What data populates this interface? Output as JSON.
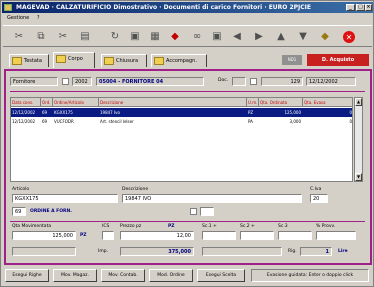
{
  "window": {
    "title": "MAGEVAD · CALZATURIFICIO Dimostrativo · Documenti di carico Fornitori · EURO 2PJCIE"
  },
  "menu": {
    "items": [
      "Gestione",
      "?"
    ]
  },
  "tabs": [
    {
      "label": "Testata"
    },
    {
      "label": "Corpo"
    },
    {
      "label": "Chiusura"
    },
    {
      "label": "Accompagn."
    }
  ],
  "header_badges": {
    "magazzino": "ND1",
    "document_type": "D. Acquisto"
  },
  "document": {
    "tipo": "Fornitore",
    "anno": "2002",
    "fornitore": "05004 - FORNITORE 04",
    "doc_label": "Doc.",
    "doc_type": "",
    "doc_number": "129",
    "doc_date": "12/12/2002"
  },
  "grid": {
    "columns": [
      "Data cons.",
      "Ord.",
      "Ordine/Articolo",
      "Descrizione",
      "U.m.",
      "Qta. Ordinata",
      "Qta. Evasa"
    ],
    "rows": [
      {
        "data": "12/12/2002",
        "ord": "69",
        "articolo": "KGXX175",
        "descrizione": "19847 Ivo",
        "um": "PZ",
        "qta_ord": "125,000",
        "qta_evasa": "0",
        "selected": true
      },
      {
        "data": "12/12/2002",
        "ord": "69",
        "articolo": "VUCFODR",
        "descrizione": "Art. stencil lelser",
        "um": "PA",
        "qta_ord": "3,000",
        "qta_evasa": "0",
        "selected": false
      }
    ]
  },
  "detail": {
    "articolo_label": "Articolo",
    "articolo": "KGXX175",
    "descrizione_label": "Descrizione",
    "descrizione": "19847 IVO",
    "iva_label": "C.Iva",
    "iva": "20",
    "ordine_num": "69",
    "ordine_text": "ORDINE A FORN.",
    "qta_label": "Qta Movimentata",
    "qta": "125,000",
    "um": "PZ",
    "ics_label": "ICS",
    "prezzo_label": "Prezzo pz",
    "prezzo_um": "PZ",
    "prezzo": "12,00",
    "sc1_label": "Sc.1 +",
    "sc2_label": "Sc.2 +",
    "sc3_label": "Sc.3",
    "provv_label": "% Provv.",
    "importo_label": "Imp.",
    "importo": "375,000",
    "righe_label": "Rig.",
    "righe": "1",
    "stato": "Lire"
  },
  "statusbar": {
    "buttons": [
      "Esegui Righe",
      "Mov. Magaz.",
      "Mov. Contab.",
      "Mod. Ordine",
      "Esegui Scelta"
    ],
    "info": "Evasione guidata: Enter o doppio click"
  },
  "colors": {
    "accent": "#a0208a",
    "title": "#0a246a",
    "selection": "#0a1c84",
    "badge": "#c81f1f"
  },
  "icons": [
    "cut-icon",
    "copy-icon",
    "paste-icon",
    "print-icon",
    "refresh-icon",
    "save-icon",
    "book-icon",
    "binoculars-icon",
    "arrow-left-icon",
    "arrow-right-icon",
    "arrow-up-icon",
    "arrow-down-icon",
    "tag-icon",
    "stop-icon"
  ]
}
